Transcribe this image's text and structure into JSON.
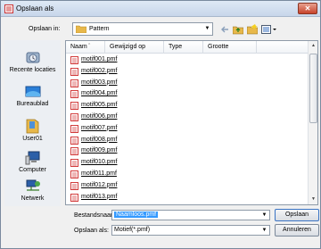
{
  "window": {
    "title": "Opslaan als"
  },
  "top": {
    "save_in_label": "Opslaan in:",
    "save_in_value": "Pattern"
  },
  "places": [
    {
      "label": "Recente locaties",
      "icon": "recent-locations-icon"
    },
    {
      "label": "Bureaublad",
      "icon": "desktop-icon"
    },
    {
      "label": "User01",
      "icon": "user-folder-icon"
    },
    {
      "label": "Computer",
      "icon": "computer-icon"
    },
    {
      "label": "Netwerk",
      "icon": "network-icon"
    }
  ],
  "columns": [
    "Naam",
    "Gewijzigd op",
    "Type",
    "Grootte"
  ],
  "files": [
    "motif001.pmf",
    "motif002.pmf",
    "motif003.pmf",
    "motif004.pmf",
    "motif005.pmf",
    "motif006.pmf",
    "motif007.pmf",
    "motif008.pmf",
    "motif009.pmf",
    "motif010.pmf",
    "motif011.pmf",
    "motif012.pmf",
    "motif013.pmf"
  ],
  "bottom": {
    "filename_label": "Bestandsnaam:",
    "filename_value": "Naamloos.pmf",
    "savetype_label": "Opslaan als:",
    "savetype_value": "Motief(*.pmf)",
    "save_button": "Opslaan",
    "cancel_button": "Annuleren"
  },
  "colors": {
    "accent": "#3399ff",
    "close": "#c7432b",
    "file_icon": "#d23c3c",
    "folder": "#e8b84a"
  }
}
